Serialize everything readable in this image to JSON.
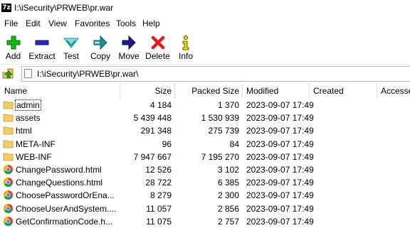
{
  "window": {
    "title": "I:\\iSecurity\\PRWEB\\pr.war",
    "app_icon": "7z"
  },
  "menu": [
    "File",
    "Edit",
    "View",
    "Favorites",
    "Tools",
    "Help"
  ],
  "toolbar": [
    {
      "label": "Add",
      "icon": "plus-icon",
      "color": "#17b417"
    },
    {
      "label": "Extract",
      "icon": "minus-icon",
      "color": "#2a2ab8"
    },
    {
      "label": "Test",
      "icon": "check-icon",
      "color": "#22a6a6"
    },
    {
      "label": "Copy",
      "icon": "copy-arrow-icon",
      "color": "#1f8f8f"
    },
    {
      "label": "Move",
      "icon": "move-arrow-icon",
      "color": "#1d1d8a"
    },
    {
      "label": "Delete",
      "icon": "delete-x-icon",
      "color": "#e21d1d"
    },
    {
      "label": "Info",
      "icon": "info-icon",
      "color": "#e6d800"
    }
  ],
  "address": {
    "path": "I:\\iSecurity\\PRWEB\\pr.war\\"
  },
  "columns": [
    "Name",
    "Size",
    "Packed Size",
    "Modified",
    "Created",
    "Accessed"
  ],
  "rows": [
    {
      "name": "admin",
      "size": "4 184",
      "packed": "1 370",
      "modified": "2023-09-07 17:49",
      "type": "folder"
    },
    {
      "name": "assets",
      "size": "5 439 448",
      "packed": "1 530 939",
      "modified": "2023-09-07 17:49",
      "type": "folder"
    },
    {
      "name": "html",
      "size": "291 348",
      "packed": "275 739",
      "modified": "2023-09-07 17:49",
      "type": "folder"
    },
    {
      "name": "META-INF",
      "size": "96",
      "packed": "84",
      "modified": "2023-09-07 17:49",
      "type": "folder"
    },
    {
      "name": "WEB-INF",
      "size": "7 947 667",
      "packed": "7 195 270",
      "modified": "2023-09-07 17:49",
      "type": "folder"
    },
    {
      "name": "ChangePassword.html",
      "size": "12 526",
      "packed": "3 102",
      "modified": "2023-09-07 17:49",
      "type": "chrome-html"
    },
    {
      "name": "ChangeQuestions.html",
      "size": "28 722",
      "packed": "6 385",
      "modified": "2023-09-07 17:49",
      "type": "chrome-html"
    },
    {
      "name": "ChoosePasswordOrEna...",
      "size": "8 279",
      "packed": "2 300",
      "modified": "2023-09-07 17:49",
      "type": "chrome-html"
    },
    {
      "name": "ChooseUserAndSystem....",
      "size": "11 057",
      "packed": "2 856",
      "modified": "2023-09-07 17:49",
      "type": "chrome-html"
    },
    {
      "name": "GetConfirmationCode.h...",
      "size": "11 075",
      "packed": "2 757",
      "modified": "2023-09-07 17:49",
      "type": "chrome-html"
    }
  ]
}
